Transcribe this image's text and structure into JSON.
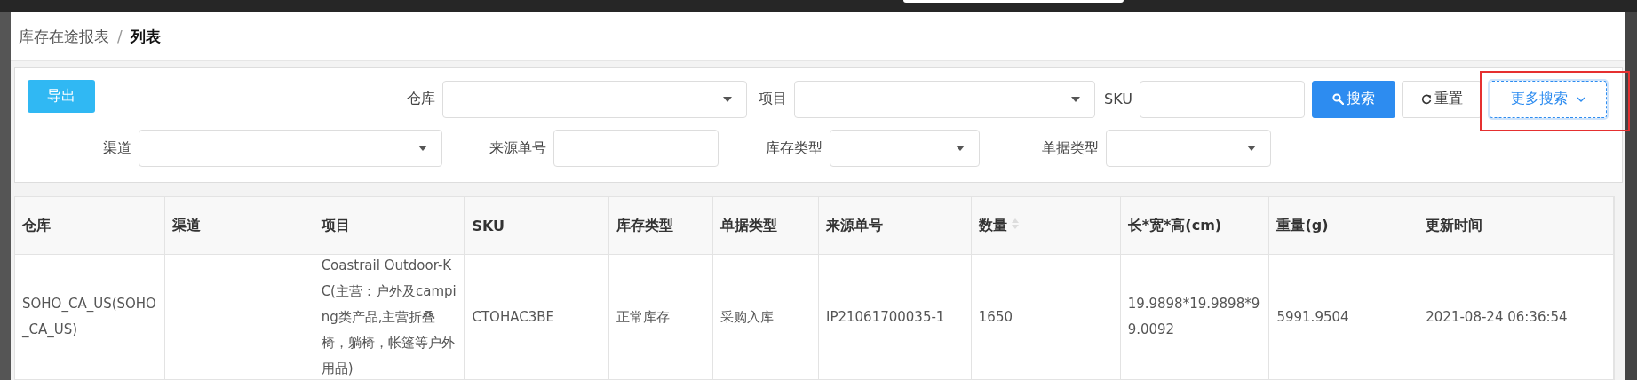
{
  "breadcrumb": {
    "parent": "库存在途报表",
    "separator": "/",
    "current": "列表"
  },
  "toolbar": {
    "export_button": "导出"
  },
  "filter_rows": [
    [
      {
        "kind": "select",
        "label": "仓库"
      },
      {
        "kind": "select",
        "label": "项目"
      },
      {
        "kind": "input",
        "label": "SKU"
      }
    ],
    [
      {
        "kind": "select",
        "label": "渠道"
      },
      {
        "kind": "input",
        "label": "来源单号"
      },
      {
        "kind": "select",
        "label": "库存类型"
      },
      {
        "kind": "select",
        "label": "单据类型"
      }
    ]
  ],
  "buttons": [
    {
      "kind": "search",
      "label": "搜索",
      "focused": false
    },
    {
      "kind": "reset",
      "label": "重置",
      "focused": false
    },
    {
      "kind": "more",
      "label": "更多搜索",
      "focused": true
    }
  ],
  "table": {
    "columns": [
      {
        "label": "仓库",
        "sortable": false
      },
      {
        "label": "渠道",
        "sortable": false
      },
      {
        "label": "项目",
        "sortable": false
      },
      {
        "label": "SKU",
        "sortable": false
      },
      {
        "label": "库存类型",
        "sortable": false
      },
      {
        "label": "单据类型",
        "sortable": false
      },
      {
        "label": "来源单号",
        "sortable": false
      },
      {
        "label": "数量",
        "sortable": true
      },
      {
        "label": "长*宽*高(cm)",
        "sortable": false
      },
      {
        "label": "重量(g)",
        "sortable": false
      },
      {
        "label": "更新时间",
        "sortable": false
      }
    ],
    "rows": [
      {
        "cells": [
          "SOHO_CA_US(SOHO_CA_US)",
          "",
          "Coastrail Outdoor-KC(主营：户外及camping类产品,主营折叠椅，躺椅，帐篷等户外用品)",
          "CTOHAC3BE",
          "正常库存",
          "采购入库",
          "IP21061700035-1",
          "1650",
          "19.9898*19.9898*99.0092",
          "5991.9504",
          "2021-08-24 06:36:54"
        ]
      }
    ]
  }
}
